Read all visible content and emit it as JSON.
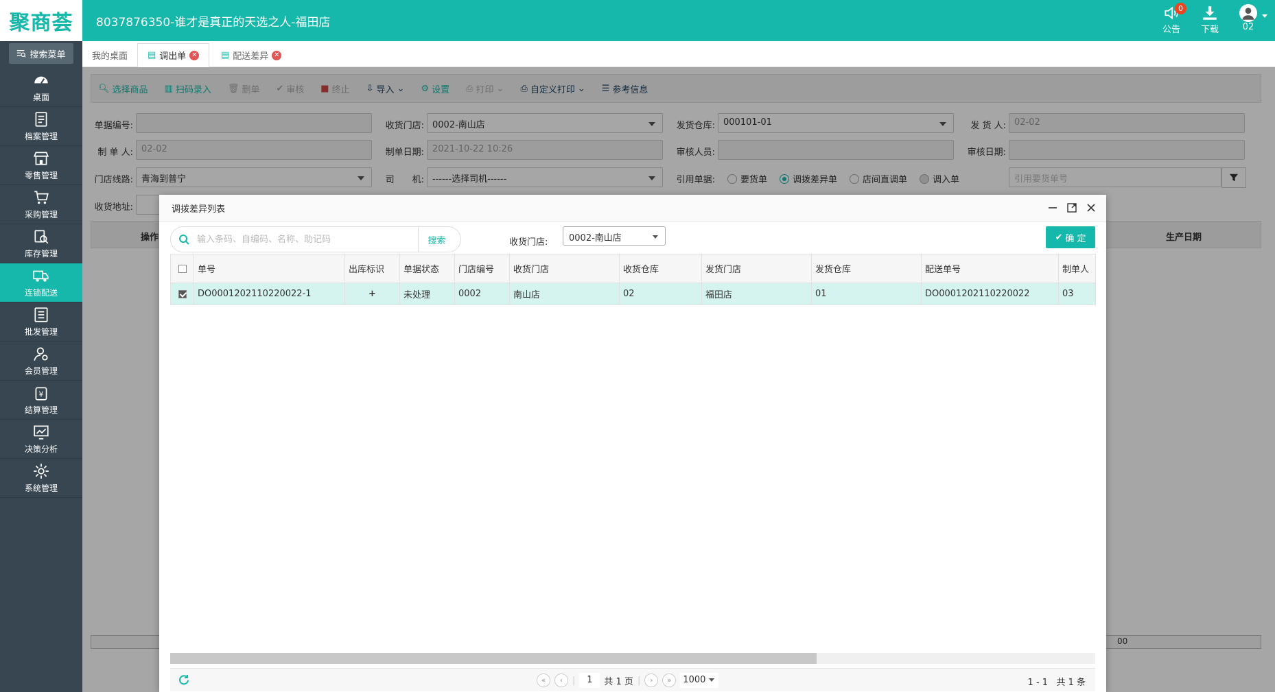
{
  "app": {
    "logo": "聚商荟",
    "title": "8037876350-谁才是真正的天选之人-福田店"
  },
  "topbar": {
    "notice_label": "公告",
    "notice_count": "0",
    "download_label": "下载",
    "user_label": "02"
  },
  "sidebar": {
    "search_label": "搜索菜单",
    "items": [
      {
        "label": "桌面",
        "icon": "dashboard-icon"
      },
      {
        "label": "档案管理",
        "icon": "file-icon"
      },
      {
        "label": "零售管理",
        "icon": "store-icon"
      },
      {
        "label": "采购管理",
        "icon": "cart-icon"
      },
      {
        "label": "库存管理",
        "icon": "stock-search-icon"
      },
      {
        "label": "连锁配送",
        "icon": "truck-icon"
      },
      {
        "label": "批发管理",
        "icon": "wholesale-icon"
      },
      {
        "label": "会员管理",
        "icon": "member-icon"
      },
      {
        "label": "结算管理",
        "icon": "settle-icon"
      },
      {
        "label": "决策分析",
        "icon": "chart-icon"
      },
      {
        "label": "系统管理",
        "icon": "gear-icon"
      }
    ],
    "active_index": 5
  },
  "tabs": [
    {
      "label": "我的桌面"
    },
    {
      "label": "调出单"
    },
    {
      "label": "配送差异"
    }
  ],
  "toolbar": {
    "select_goods": "选择商品",
    "scan_input": "扫码录入",
    "delete": "删单",
    "audit": "审核",
    "terminate": "终止",
    "import": "导入",
    "settings": "设置",
    "print": "打印",
    "custom_print": "自定义打印",
    "reference": "参考信息"
  },
  "form": {
    "doc_no_label": "单据编号:",
    "doc_no_value": "",
    "receive_store_label": "收货门店:",
    "receive_store_value": "0002-南山店",
    "send_warehouse_label": "发货仓库:",
    "send_warehouse_value": "000101-01",
    "sender_label": "发 货 人:",
    "sender_value": "02-02",
    "maker_label": "制 单 人:",
    "maker_value": "02-02",
    "make_date_label": "制单日期:",
    "make_date_value": "2021-10-22 10:26",
    "auditor_label": "审核人员:",
    "auditor_value": "",
    "audit_date_label": "审核日期:",
    "audit_date_value": "",
    "route_label": "门店线路:",
    "route_value": "青海到普宁",
    "driver_label": "司　　机:",
    "driver_value": "------选择司机------",
    "ref_doc_label": "引用单据:",
    "ref_options": [
      "要货单",
      "调拨差异单",
      "店间直调单",
      "调入单"
    ],
    "ref_selected": 1,
    "ref_placeholder": "引用要货单号",
    "address_label": "收货地址:"
  },
  "bg_table": {
    "op_header": "操作",
    "production_date_header": "生产日期",
    "footer_value": "00"
  },
  "modal": {
    "title": "调拨差异列表",
    "search_placeholder": "输入条码、自编码、名称、助记码",
    "search_button": "搜索",
    "store_label": "收货门店:",
    "store_value": "0002-南山店",
    "confirm_button": "确 定",
    "columns": [
      "单号",
      "出库标识",
      "单据状态",
      "门店编号",
      "收货门店",
      "收货仓库",
      "发货门店",
      "发货仓库",
      "配送单号",
      "制单人"
    ],
    "rows": [
      {
        "checked": true,
        "doc_no": "DO0001202110220022-1",
        "out_flag": "+",
        "status": "未处理",
        "store_no": "0002",
        "recv_store": "南山店",
        "recv_wh": "02",
        "send_store": "福田店",
        "send_wh": "01",
        "delivery_no": "DO0001202110220022",
        "maker": "03"
      }
    ],
    "pager": {
      "page": "1",
      "total_pages": "共 1 页",
      "page_size": "1000",
      "range": "1 - 1",
      "total": "共 1 条"
    }
  },
  "colors": {
    "brand": "#15b8aa",
    "sidebar": "#374651",
    "row_selected": "#d5f4f0"
  }
}
